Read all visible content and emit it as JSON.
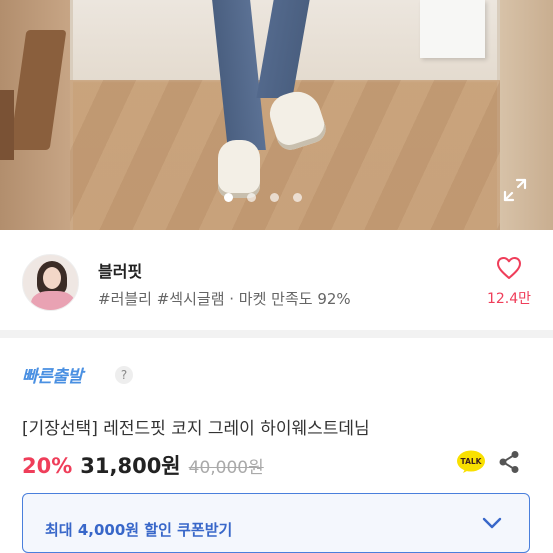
{
  "hero": {
    "image_alt": "product photo: cuffed grey denim jeans with white sneakers",
    "carousel": {
      "slides": 4,
      "active": 0
    },
    "expand_icon": "expand-fullscreen-icon"
  },
  "seller": {
    "name": "블러핏",
    "tags": "#러블리 #섹시글램 · 마켓 만족도 92%",
    "like_icon": "heart-outline-icon",
    "like_count": "12.4만"
  },
  "product": {
    "badge": "빠른출발",
    "help_icon": "?",
    "title": "[기장선택] 레전드핏 코지 그레이 하이웨스트데님",
    "discount": "20%",
    "price": "31,800원",
    "original_price": "40,000원",
    "talk_label": "TALK",
    "share_icon": "share-icon"
  },
  "coupon": {
    "label": "최대 4,000원 할인 쿠폰받기",
    "chevron_icon": "chevron-down-icon"
  },
  "colors": {
    "accent_pink": "#ef3e5a",
    "accent_blue": "#4a90e2",
    "coupon_blue": "#3867c9",
    "kakao_yellow": "#f9e000"
  }
}
